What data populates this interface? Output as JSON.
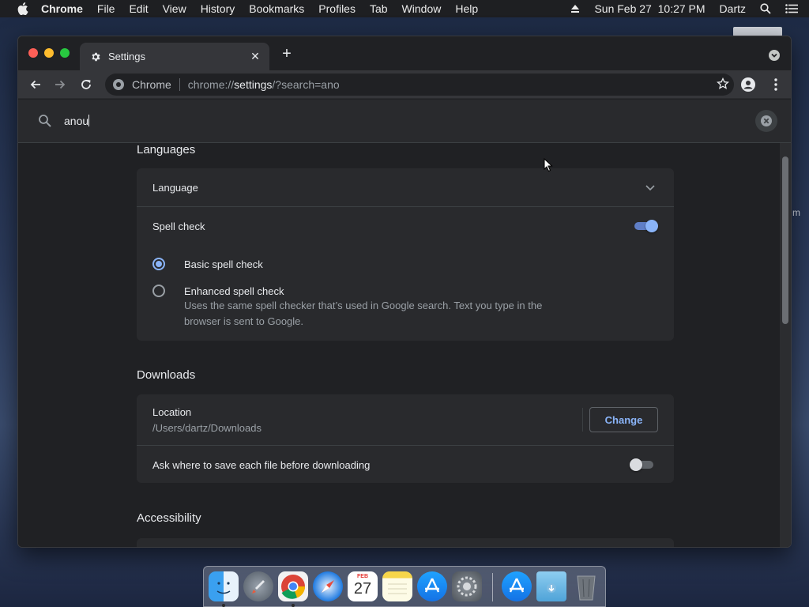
{
  "menubar": {
    "app": "Chrome",
    "items": [
      "File",
      "Edit",
      "View",
      "History",
      "Bookmarks",
      "Profiles",
      "Tab",
      "Window",
      "Help"
    ],
    "datetime": "Sun Feb 27  10:27 PM",
    "user": "Dartz"
  },
  "desktop": {
    "peek_text": "m"
  },
  "browser": {
    "tab_title": "Settings",
    "omnibox": {
      "chip": "Chrome",
      "url_prefix": "chrome://",
      "url_host": "settings",
      "url_rest": "/?search=ano"
    }
  },
  "search": {
    "query": "anou"
  },
  "languages": {
    "title": "Languages",
    "language_label": "Language",
    "spell_check_label": "Spell check",
    "spell_check_on": true,
    "basic_label": "Basic spell check",
    "enhanced_label": "Enhanced spell check",
    "enhanced_desc": "Uses the same spell checker that’s used in Google search. Text you type in the browser is sent to Google.",
    "selected": "basic"
  },
  "downloads": {
    "title": "Downloads",
    "location_label": "Location",
    "location_path": "/Users/dartz/Downloads",
    "change_label": "Change",
    "ask_label": "Ask where to save each file before downloading",
    "ask_on": false
  },
  "accessibility": {
    "title": "Accessibility"
  },
  "dock": {
    "calendar_month": "FEB",
    "calendar_day": "27",
    "items": [
      "finder-icon",
      "launchpad-icon",
      "chrome-icon",
      "safari-icon",
      "calendar-icon",
      "notes-icon",
      "app-store-icon",
      "system-preferences-icon",
      "app-store-download-icon",
      "downloads-folder-icon",
      "trash-icon"
    ]
  },
  "colors": {
    "accent": "#8ab4f8",
    "surface": "#292a2d",
    "background": "#202124"
  }
}
